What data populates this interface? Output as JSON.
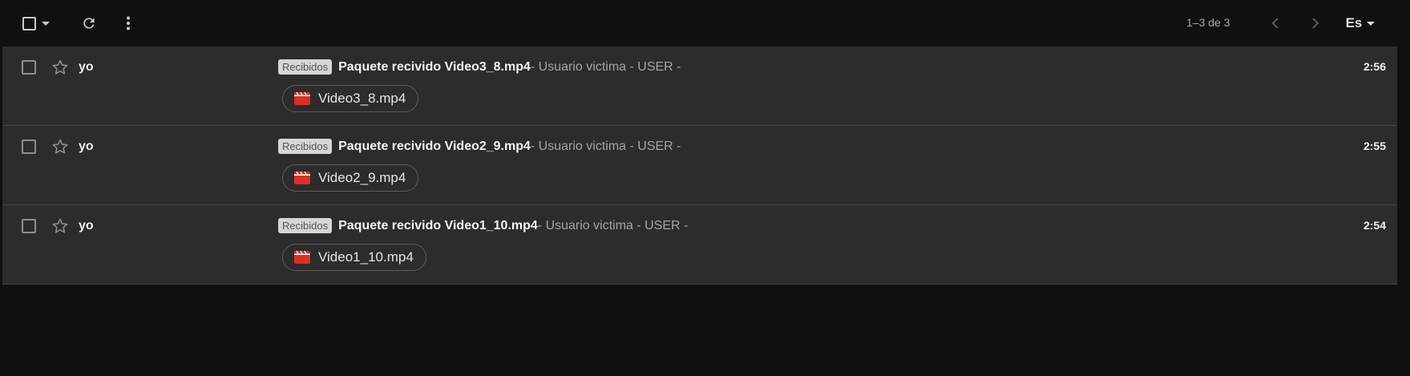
{
  "toolbar": {
    "pager": "1–3 de 3",
    "language": "Es"
  },
  "icons": {
    "select_all": "checkbox-icon",
    "refresh": "refresh-icon",
    "more": "more-vert-icon",
    "prev": "chevron-left-icon",
    "next": "chevron-right-icon",
    "star": "star-outline-icon",
    "video_file": "video-file-icon"
  },
  "colors": {
    "background": "#101010",
    "row_background": "#2c2c2c",
    "label_chip": "#d6d6d6",
    "video_icon_red": "#d93025"
  },
  "messages": [
    {
      "sender": "yo",
      "label": "Recibidos",
      "subject": "Paquete recivido Video3_8.mp4",
      "snippet": " - Usuario victima - USER -",
      "time": "2:56",
      "attachment": "Video3_8.mp4"
    },
    {
      "sender": "yo",
      "label": "Recibidos",
      "subject": "Paquete recivido Video2_9.mp4",
      "snippet": " - Usuario victima - USER -",
      "time": "2:55",
      "attachment": "Video2_9.mp4"
    },
    {
      "sender": "yo",
      "label": "Recibidos",
      "subject": "Paquete recivido Video1_10.mp4",
      "snippet": " - Usuario victima - USER -",
      "time": "2:54",
      "attachment": "Video1_10.mp4"
    }
  ]
}
